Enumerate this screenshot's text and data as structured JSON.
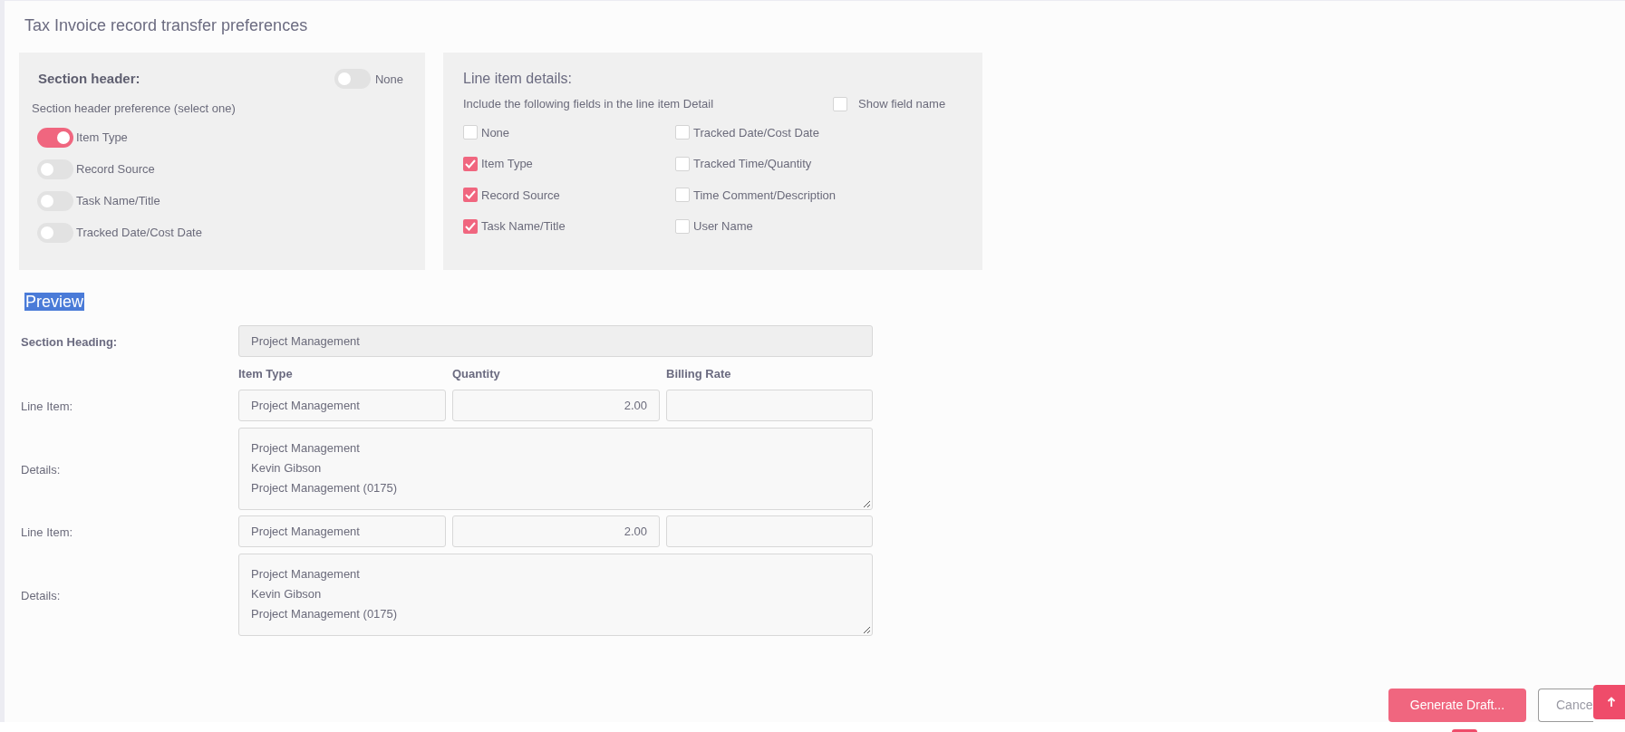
{
  "title": "Tax Invoice record transfer preferences",
  "section_header": {
    "heading": "Section header:",
    "none_toggle": {
      "label": "None",
      "on": false
    },
    "hint": "Section header preference (select one)",
    "options": [
      {
        "label": "Item Type",
        "on": true
      },
      {
        "label": "Record Source",
        "on": false
      },
      {
        "label": "Task Name/Title",
        "on": false
      },
      {
        "label": "Tracked Date/Cost Date",
        "on": false
      }
    ]
  },
  "line_item_details": {
    "heading": "Line item details:",
    "hint": "Include the following fields in the line item Detail",
    "show_field_name": {
      "label": "Show field name",
      "checked": false
    },
    "fields": [
      {
        "label": "None",
        "checked": false
      },
      {
        "label": "Tracked Date/Cost Date",
        "checked": false
      },
      {
        "label": "Item Type",
        "checked": true
      },
      {
        "label": "Tracked Time/Quantity",
        "checked": false
      },
      {
        "label": "Record Source",
        "checked": true
      },
      {
        "label": "Time Comment/Description",
        "checked": false
      },
      {
        "label": "Task Name/Title",
        "checked": true
      },
      {
        "label": "User Name",
        "checked": false
      }
    ]
  },
  "preview": {
    "title": "Preview",
    "section_heading_label": "Section Heading:",
    "section_heading_value": "Project Management",
    "columns": [
      "Item Type",
      "Quantity",
      "Billing Rate"
    ],
    "lines": [
      {
        "line_label": "Line Item:",
        "item_type": "Project Management",
        "quantity": "2.00",
        "details_label": "Details:",
        "details": [
          "Project Management",
          "Kevin Gibson",
          "Project Management (0175)"
        ]
      },
      {
        "line_label": "Line Item:",
        "item_type": "Project Management",
        "quantity": "2.00",
        "details_label": "Details:",
        "details": [
          "Project Management",
          "Kevin Gibson",
          "Project Management (0175)"
        ]
      }
    ]
  },
  "buttons": {
    "generate": "Generate Draft...",
    "cancel": "Cance"
  }
}
